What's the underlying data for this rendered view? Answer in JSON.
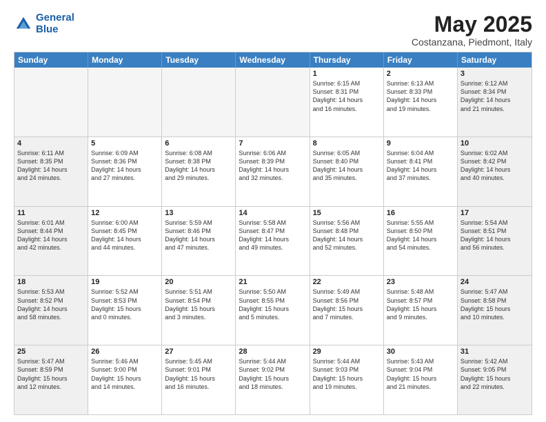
{
  "header": {
    "logo_line1": "General",
    "logo_line2": "Blue",
    "title": "May 2025",
    "subtitle": "Costanzana, Piedmont, Italy"
  },
  "days": [
    "Sunday",
    "Monday",
    "Tuesday",
    "Wednesday",
    "Thursday",
    "Friday",
    "Saturday"
  ],
  "weeks": [
    [
      {
        "day": "",
        "text": ""
      },
      {
        "day": "",
        "text": ""
      },
      {
        "day": "",
        "text": ""
      },
      {
        "day": "",
        "text": ""
      },
      {
        "day": "1",
        "text": "Sunrise: 6:15 AM\nSunset: 8:31 PM\nDaylight: 14 hours\nand 16 minutes."
      },
      {
        "day": "2",
        "text": "Sunrise: 6:13 AM\nSunset: 8:33 PM\nDaylight: 14 hours\nand 19 minutes."
      },
      {
        "day": "3",
        "text": "Sunrise: 6:12 AM\nSunset: 8:34 PM\nDaylight: 14 hours\nand 21 minutes."
      }
    ],
    [
      {
        "day": "4",
        "text": "Sunrise: 6:11 AM\nSunset: 8:35 PM\nDaylight: 14 hours\nand 24 minutes."
      },
      {
        "day": "5",
        "text": "Sunrise: 6:09 AM\nSunset: 8:36 PM\nDaylight: 14 hours\nand 27 minutes."
      },
      {
        "day": "6",
        "text": "Sunrise: 6:08 AM\nSunset: 8:38 PM\nDaylight: 14 hours\nand 29 minutes."
      },
      {
        "day": "7",
        "text": "Sunrise: 6:06 AM\nSunset: 8:39 PM\nDaylight: 14 hours\nand 32 minutes."
      },
      {
        "day": "8",
        "text": "Sunrise: 6:05 AM\nSunset: 8:40 PM\nDaylight: 14 hours\nand 35 minutes."
      },
      {
        "day": "9",
        "text": "Sunrise: 6:04 AM\nSunset: 8:41 PM\nDaylight: 14 hours\nand 37 minutes."
      },
      {
        "day": "10",
        "text": "Sunrise: 6:02 AM\nSunset: 8:42 PM\nDaylight: 14 hours\nand 40 minutes."
      }
    ],
    [
      {
        "day": "11",
        "text": "Sunrise: 6:01 AM\nSunset: 8:44 PM\nDaylight: 14 hours\nand 42 minutes."
      },
      {
        "day": "12",
        "text": "Sunrise: 6:00 AM\nSunset: 8:45 PM\nDaylight: 14 hours\nand 44 minutes."
      },
      {
        "day": "13",
        "text": "Sunrise: 5:59 AM\nSunset: 8:46 PM\nDaylight: 14 hours\nand 47 minutes."
      },
      {
        "day": "14",
        "text": "Sunrise: 5:58 AM\nSunset: 8:47 PM\nDaylight: 14 hours\nand 49 minutes."
      },
      {
        "day": "15",
        "text": "Sunrise: 5:56 AM\nSunset: 8:48 PM\nDaylight: 14 hours\nand 52 minutes."
      },
      {
        "day": "16",
        "text": "Sunrise: 5:55 AM\nSunset: 8:50 PM\nDaylight: 14 hours\nand 54 minutes."
      },
      {
        "day": "17",
        "text": "Sunrise: 5:54 AM\nSunset: 8:51 PM\nDaylight: 14 hours\nand 56 minutes."
      }
    ],
    [
      {
        "day": "18",
        "text": "Sunrise: 5:53 AM\nSunset: 8:52 PM\nDaylight: 14 hours\nand 58 minutes."
      },
      {
        "day": "19",
        "text": "Sunrise: 5:52 AM\nSunset: 8:53 PM\nDaylight: 15 hours\nand 0 minutes."
      },
      {
        "day": "20",
        "text": "Sunrise: 5:51 AM\nSunset: 8:54 PM\nDaylight: 15 hours\nand 3 minutes."
      },
      {
        "day": "21",
        "text": "Sunrise: 5:50 AM\nSunset: 8:55 PM\nDaylight: 15 hours\nand 5 minutes."
      },
      {
        "day": "22",
        "text": "Sunrise: 5:49 AM\nSunset: 8:56 PM\nDaylight: 15 hours\nand 7 minutes."
      },
      {
        "day": "23",
        "text": "Sunrise: 5:48 AM\nSunset: 8:57 PM\nDaylight: 15 hours\nand 9 minutes."
      },
      {
        "day": "24",
        "text": "Sunrise: 5:47 AM\nSunset: 8:58 PM\nDaylight: 15 hours\nand 10 minutes."
      }
    ],
    [
      {
        "day": "25",
        "text": "Sunrise: 5:47 AM\nSunset: 8:59 PM\nDaylight: 15 hours\nand 12 minutes."
      },
      {
        "day": "26",
        "text": "Sunrise: 5:46 AM\nSunset: 9:00 PM\nDaylight: 15 hours\nand 14 minutes."
      },
      {
        "day": "27",
        "text": "Sunrise: 5:45 AM\nSunset: 9:01 PM\nDaylight: 15 hours\nand 16 minutes."
      },
      {
        "day": "28",
        "text": "Sunrise: 5:44 AM\nSunset: 9:02 PM\nDaylight: 15 hours\nand 18 minutes."
      },
      {
        "day": "29",
        "text": "Sunrise: 5:44 AM\nSunset: 9:03 PM\nDaylight: 15 hours\nand 19 minutes."
      },
      {
        "day": "30",
        "text": "Sunrise: 5:43 AM\nSunset: 9:04 PM\nDaylight: 15 hours\nand 21 minutes."
      },
      {
        "day": "31",
        "text": "Sunrise: 5:42 AM\nSunset: 9:05 PM\nDaylight: 15 hours\nand 22 minutes."
      }
    ]
  ]
}
